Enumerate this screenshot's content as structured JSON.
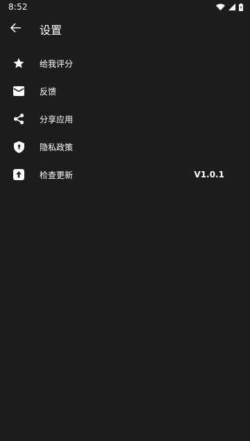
{
  "status_bar": {
    "time": "8:52",
    "icons": [
      "wifi-icon",
      "signal-icon",
      "battery-icon"
    ]
  },
  "header": {
    "back_icon": "arrow-left-icon",
    "title": "设置"
  },
  "menu": {
    "items": [
      {
        "icon": "star-icon",
        "label": "给我评分",
        "value": ""
      },
      {
        "icon": "envelope-icon",
        "label": "反馈",
        "value": ""
      },
      {
        "icon": "share-icon",
        "label": "分享应用",
        "value": ""
      },
      {
        "icon": "shield-icon",
        "label": "隐私政策",
        "value": ""
      },
      {
        "icon": "upload-icon",
        "label": "检查更新",
        "value": "V1.0.1"
      }
    ]
  },
  "colors": {
    "background": "#1c1c1e",
    "text": "#ffffff"
  }
}
